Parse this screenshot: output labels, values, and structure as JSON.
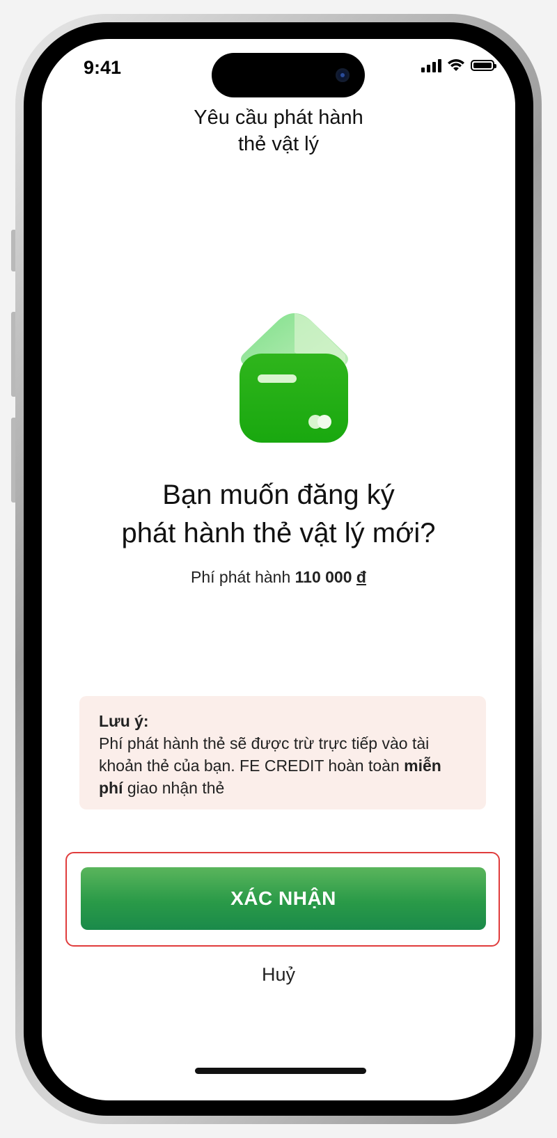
{
  "status_bar": {
    "time": "9:41"
  },
  "header": {
    "title": "Yêu cầu phát hành\nthẻ vật lý"
  },
  "main": {
    "headline_line1": "Bạn muốn đăng ký",
    "headline_line2": "phát hành thẻ vật lý mới?",
    "fee_label": "Phí phát hành",
    "fee_amount": "110 000",
    "fee_currency": "đ"
  },
  "note": {
    "title": "Lưu ý:",
    "text_part1": "Phí phát hành thẻ sẽ được trừ trực tiếp vào tài khoản thẻ của bạn. FE CREDIT hoàn toàn",
    "text_bold": "miễn phí",
    "text_part2": "giao nhận thẻ"
  },
  "actions": {
    "confirm_label": "XÁC NHẬN",
    "cancel_label": "Huỷ"
  },
  "colors": {
    "primary_green": "#1f9b48",
    "note_background": "#fbeeea",
    "highlight_border": "#e03c3c"
  }
}
